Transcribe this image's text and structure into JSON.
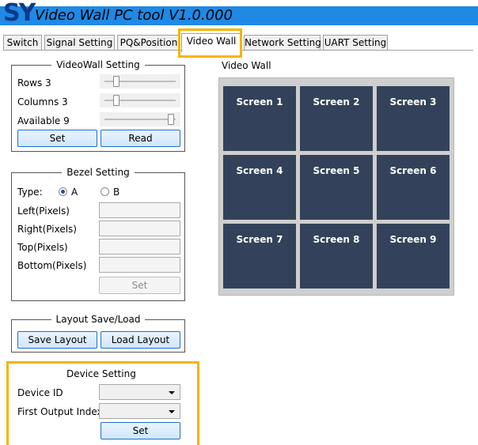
{
  "app": {
    "logo_text": "SY",
    "title": "Video Wall PC tool V1.0.000"
  },
  "tabs": [
    {
      "label": "Switch",
      "active": false
    },
    {
      "label": "Signal Setting",
      "active": false
    },
    {
      "label": "PQ&Position",
      "active": false
    },
    {
      "label": "Video Wall",
      "active": true
    },
    {
      "label": "Network Setting",
      "active": false
    },
    {
      "label": "UART Setting",
      "active": false
    }
  ],
  "videowall_setting": {
    "title": "VideoWall Setting",
    "rows_label": "Rows 3",
    "columns_label": "Columns 3",
    "available_label": "Available 9",
    "rows_value": 3,
    "columns_value": 3,
    "available_value": 9,
    "set_button": "Set",
    "read_button": "Read"
  },
  "bezel_setting": {
    "title": "Bezel Setting",
    "type_label": "Type:",
    "option_a": "A",
    "option_b": "B",
    "selected": "A",
    "left_label": "Left(Pixels)",
    "right_label": "Right(Pixels)",
    "top_label": "Top(Pixels)",
    "bottom_label": "Bottom(Pixels)",
    "set_button": "Set"
  },
  "layout": {
    "title": "Layout Save/Load",
    "save_button": "Save Layout",
    "load_button": "Load Layout"
  },
  "device_setting": {
    "title": "Device Setting",
    "device_id_label": "Device ID",
    "first_output_label": "First Output Index",
    "device_id_value": "",
    "first_output_value": "",
    "set_button": "Set"
  },
  "video_wall": {
    "title": "Video Wall",
    "screens": [
      "Screen 1",
      "Screen 2",
      "Screen 3",
      "Screen 4",
      "Screen 5",
      "Screen 6",
      "Screen 7",
      "Screen 8",
      "Screen 9"
    ]
  },
  "colors": {
    "title_band": "#1f89e5",
    "screen_bg": "#33425a",
    "highlight": "#f5b400",
    "button_border": "#1d6fc8"
  }
}
